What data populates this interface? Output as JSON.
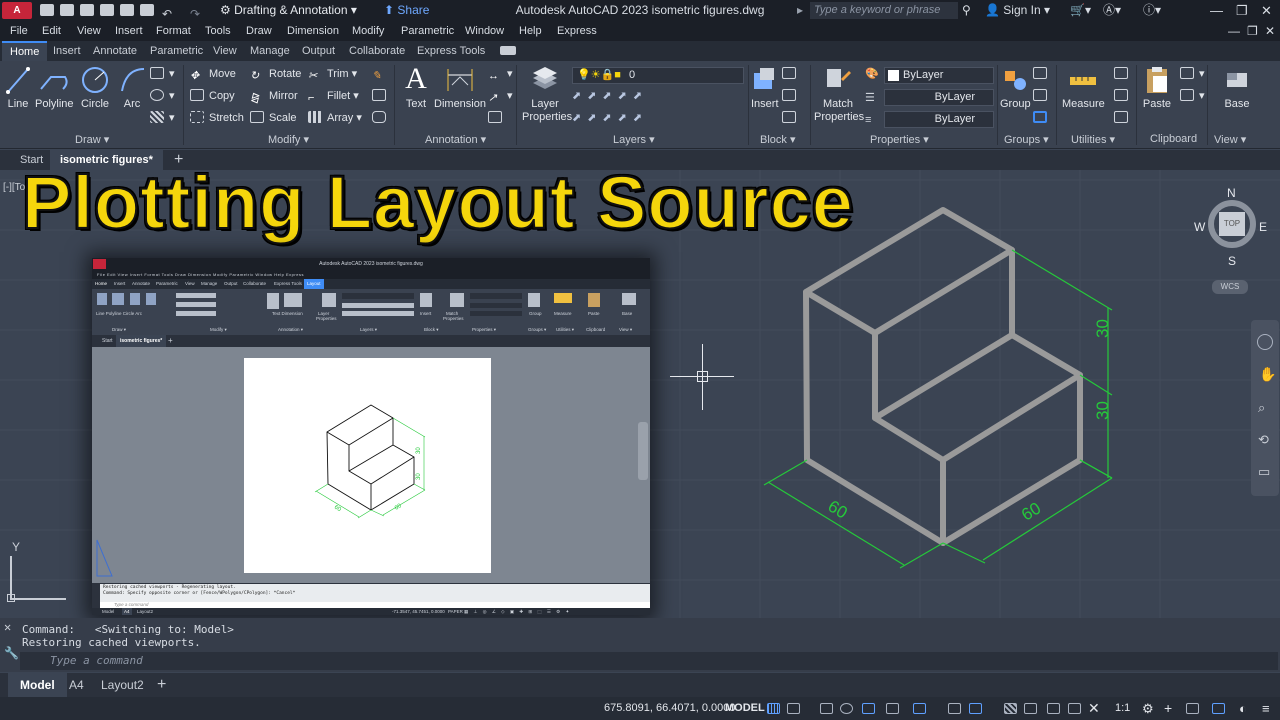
{
  "window": {
    "app_badge": "A CAD",
    "workspace": "Drafting & Annotation",
    "share": "Share",
    "title": "Autodesk AutoCAD 2023    isometric figures.dwg",
    "search_placeholder": "Type a keyword or phrase",
    "sign_in": "Sign In"
  },
  "menu": [
    "File",
    "Edit",
    "View",
    "Insert",
    "Format",
    "Tools",
    "Draw",
    "Dimension",
    "Modify",
    "Parametric",
    "Window",
    "Help",
    "Express"
  ],
  "ribbon_tabs": [
    "Home",
    "Insert",
    "Annotate",
    "Parametric",
    "View",
    "Manage",
    "Output",
    "Collaborate",
    "Express Tools"
  ],
  "ribbon": {
    "draw": {
      "line": "Line",
      "polyline": "Polyline",
      "circle": "Circle",
      "arc": "Arc",
      "label": "Draw"
    },
    "modify": {
      "move": "Move",
      "rotate": "Rotate",
      "trim": "Trim",
      "copy": "Copy",
      "mirror": "Mirror",
      "fillet": "Fillet",
      "stretch": "Stretch",
      "scale": "Scale",
      "array": "Array",
      "label": "Modify"
    },
    "annotation": {
      "text": "Text",
      "dimension": "Dimension",
      "label": "Annotation"
    },
    "layers": {
      "layer_properties": "Layer Properties",
      "current_layer": "0",
      "label": "Layers"
    },
    "block": {
      "insert": "Insert",
      "label": "Block"
    },
    "properties": {
      "match": "Match Properties",
      "bylayer1": "ByLayer",
      "bylayer2": "ByLayer",
      "bylayer3": "ByLayer",
      "label": "Properties"
    },
    "groups": {
      "group": "Group",
      "label": "Groups"
    },
    "utilities": {
      "measure": "Measure",
      "label": "Utilities"
    },
    "clipboard": {
      "paste": "Paste",
      "label": "Clipboard"
    },
    "view": {
      "base": "Base",
      "label": "View"
    }
  },
  "file_tabs": {
    "start": "Start",
    "active": "isometric figures*"
  },
  "viewport_label": "[-][To",
  "headline": "Plotting Layout Source",
  "viewcube": {
    "north": "N",
    "south": "S",
    "east": "E",
    "west": "W",
    "face": "TOP",
    "wcs": "WCS"
  },
  "ucs": {
    "y": "Y"
  },
  "drawing_dims": {
    "right_top": "30",
    "right_bottom": "30",
    "left_bottom": "60",
    "right_base": "60"
  },
  "inset": {
    "title": "Autodesk AutoCAD 2023    isometric figures.dwg",
    "tabs": [
      "Home",
      "Insert",
      "Annotate",
      "Parametric",
      "View",
      "Manage",
      "Output",
      "Collaborate",
      "Express Tools",
      "Layout"
    ],
    "file_tabs": [
      "Start",
      "isometric figures*"
    ],
    "cmd_line1": "Restoring cached viewports - Regenerating layout.",
    "cmd_line2": "Command: Specify opposite corner or [Fence/WPolygon/CPolygon]: *Cancel*",
    "cmd_placeholder": "Type a command",
    "layout_tabs": [
      "Model",
      "A4",
      "Layout2"
    ],
    "coords": "-71.3547, 45.7451, 0.0000",
    "paper": "PAPER",
    "dims": {
      "right_top": "30",
      "right_bottom": "30",
      "left_bottom": "60",
      "right_base": "60"
    }
  },
  "command": {
    "line1_label": "Command:",
    "line1_value": "<Switching to: Model>",
    "line2": "Restoring cached viewports.",
    "placeholder": "Type a command"
  },
  "layout_tabs": [
    "Model",
    "A4",
    "Layout2"
  ],
  "status": {
    "coords": "675.8091, 66.4071, 0.0000",
    "mode": "MODEL",
    "scale": "1:1"
  }
}
